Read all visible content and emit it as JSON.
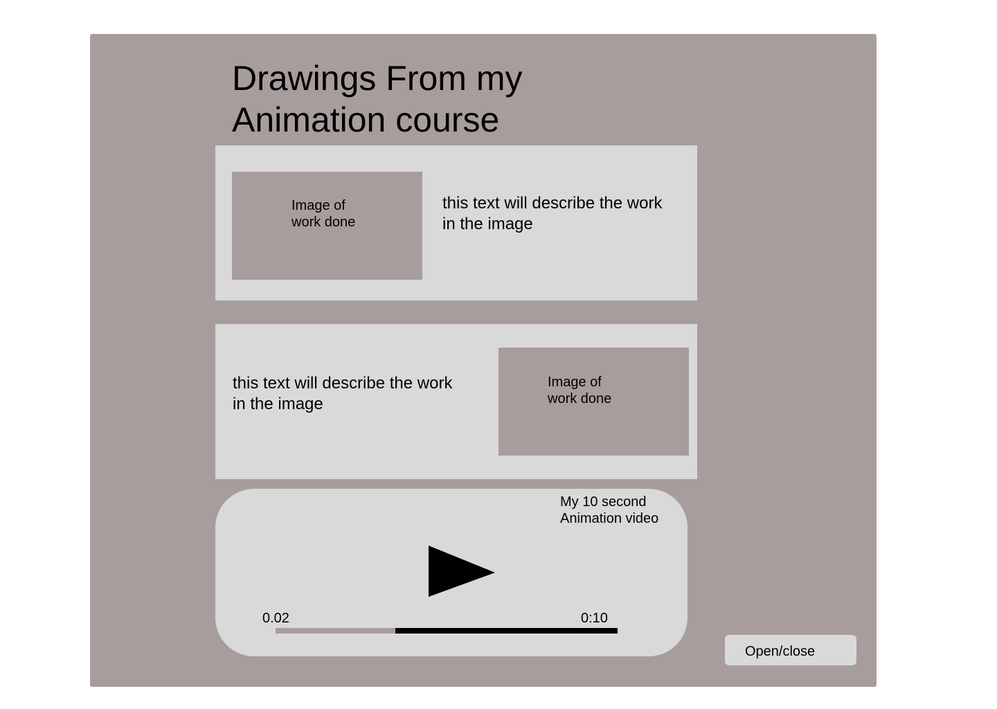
{
  "page": {
    "title": "Drawings From my\nAnimation course"
  },
  "cards": [
    {
      "image_label": "Image of\nwork done",
      "description": "this text will describe the work\nin the image"
    },
    {
      "image_label": "Image of\nwork done",
      "description": "this text will describe the work\nin the image"
    }
  ],
  "video": {
    "title": "My 10 second\nAnimation video",
    "current_time": "0.02",
    "duration": "0:10",
    "progress_fraction": 0.35,
    "play_icon": "play-icon"
  },
  "toggle": {
    "label": "Open/close"
  },
  "colors": {
    "background": "#a89d9d",
    "card": "#d9d9d9",
    "progress_track": "#000000",
    "progress_fill": "#a89d9d"
  }
}
